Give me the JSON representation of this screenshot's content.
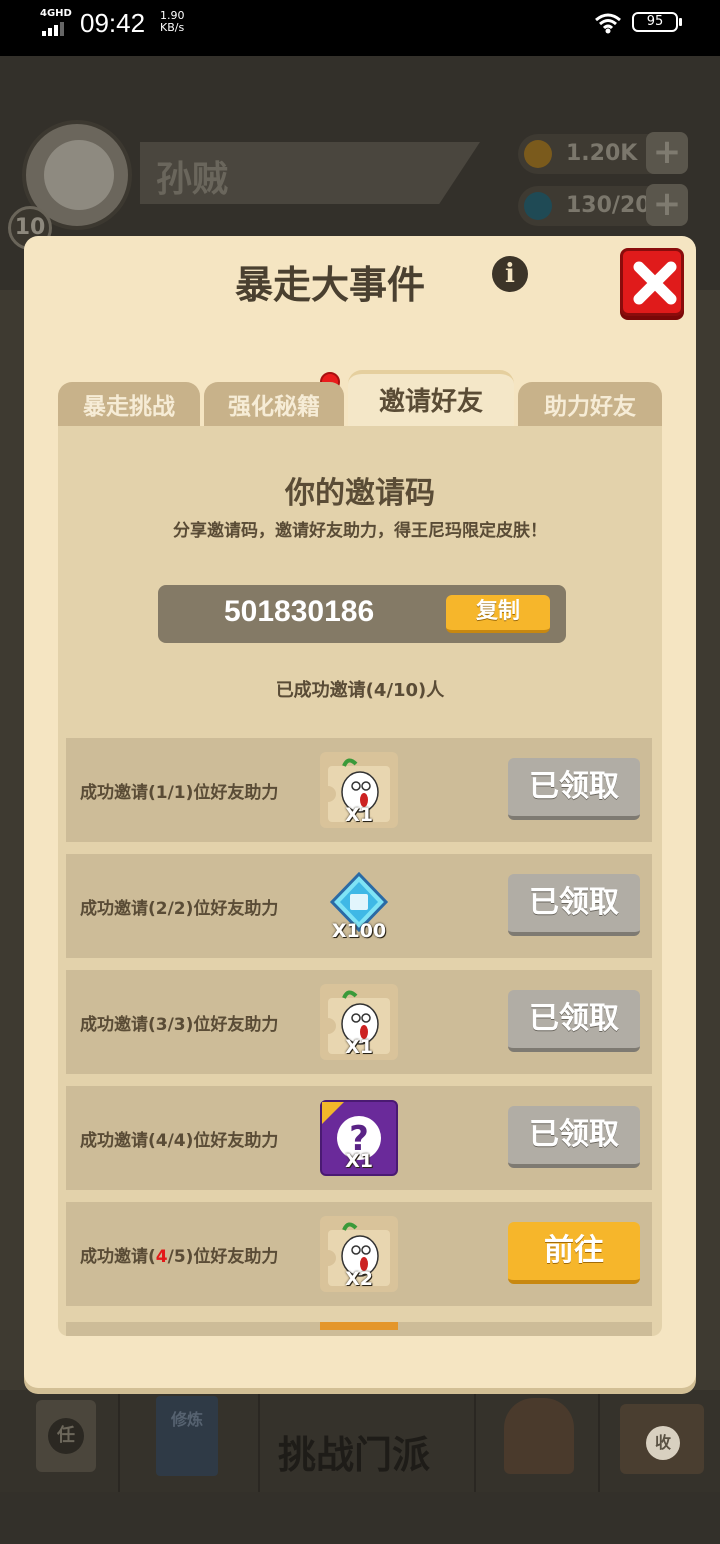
{
  "status_bar": {
    "network": "4GHD",
    "time": "09:42",
    "speed_value": "1.90",
    "speed_unit": "KB/s",
    "battery": "95"
  },
  "background": {
    "player_name": "孙贼",
    "player_level": "10",
    "coins": "1.20K",
    "energy": "130/20",
    "nav_task": "任",
    "nav_book": "修炼",
    "nav_center": "挑战门派",
    "nav_shop": "收"
  },
  "panel": {
    "title": "暴走大事件",
    "info_glyph": "i",
    "tabs": [
      {
        "label": "暴走挑战",
        "active": false
      },
      {
        "label": "强化秘籍",
        "active": false,
        "badge": true
      },
      {
        "label": "邀请好友",
        "active": true
      },
      {
        "label": "助力好友",
        "active": false
      }
    ],
    "invite": {
      "title": "你的邀请码",
      "subtitle": "分享邀请码，邀请好友助力，得王尼玛限定皮肤！",
      "code": "501830186",
      "copy_label": "复制",
      "count_text": "已成功邀请(4/10)人"
    },
    "rewards": [
      {
        "label": "成功邀请(1/1)位好友助力",
        "item": "wangnima-fragment-icon",
        "qty": "X1",
        "button": "已领取",
        "state": "claimed"
      },
      {
        "label": "成功邀请(2/2)位好友助力",
        "item": "multiplier-gem-icon",
        "qty": "X100",
        "button": "已领取",
        "state": "claimed"
      },
      {
        "label": "成功邀请(3/3)位好友助力",
        "item": "wangnima-fragment-icon",
        "qty": "X1",
        "button": "已领取",
        "state": "claimed"
      },
      {
        "label": "成功邀请(4/4)位好友助力",
        "item": "mystery-box-icon",
        "qty": "X1",
        "button": "已领取",
        "state": "claimed"
      },
      {
        "label_pre": "成功邀请(",
        "label_hl": "4",
        "label_post": "/5)位好友助力",
        "item": "wangnima-fragment-icon",
        "qty": "X2",
        "button": "前往",
        "state": "go"
      }
    ]
  },
  "colors": {
    "panel_bg": "#f5e5c2",
    "accent_orange": "#f6b62b",
    "claimed_gray": "#b1ada5",
    "close_red": "#e01b1b",
    "highlight_red": "#e41818"
  }
}
